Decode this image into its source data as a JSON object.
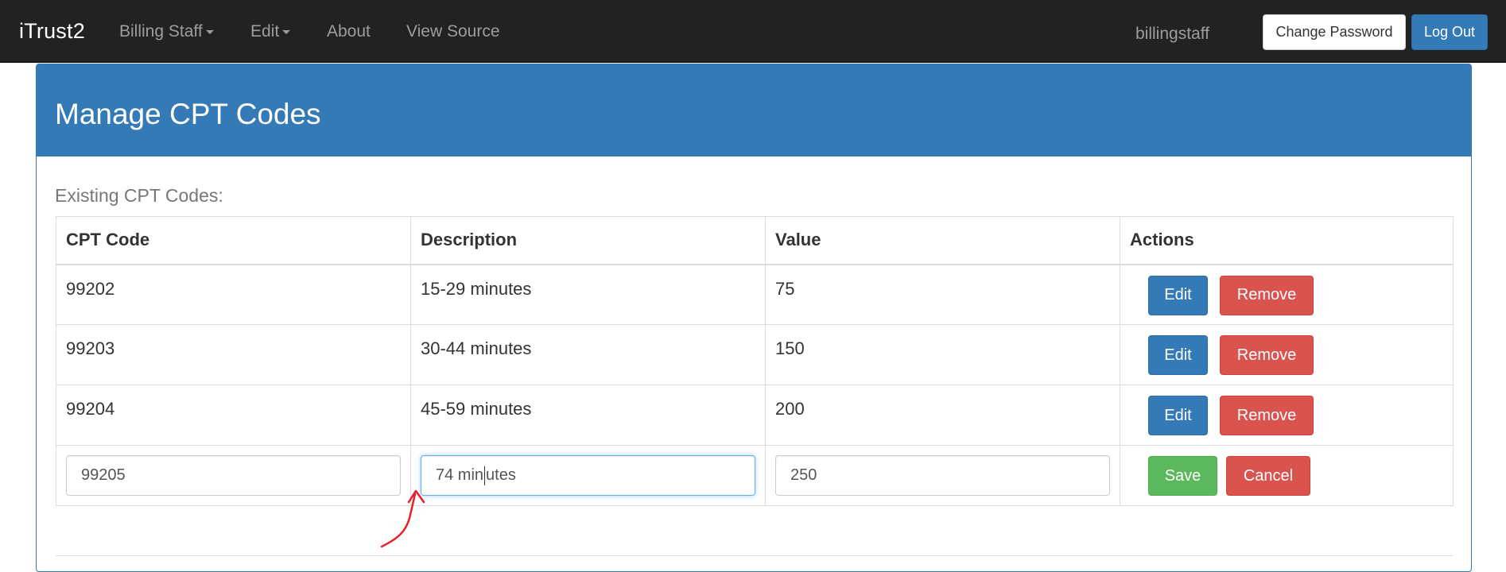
{
  "navbar": {
    "brand": "iTrust2",
    "menu": [
      {
        "label": "Billing Staff",
        "dropdown": true
      },
      {
        "label": "Edit",
        "dropdown": true
      },
      {
        "label": "About",
        "dropdown": false
      },
      {
        "label": "View Source",
        "dropdown": false
      }
    ],
    "username": "billingstaff",
    "change_password_label": "Change Password",
    "logout_label": "Log Out"
  },
  "panel": {
    "title": "Manage CPT Codes",
    "section_label": "Existing CPT Codes:"
  },
  "table": {
    "headers": [
      "CPT Code",
      "Description",
      "Value",
      "Actions"
    ],
    "rows": [
      {
        "code": "99202",
        "description": "15-29 minutes",
        "value": "75"
      },
      {
        "code": "99203",
        "description": "30-44 minutes",
        "value": "150"
      },
      {
        "code": "99204",
        "description": "45-59 minutes",
        "value": "200"
      }
    ],
    "edit_label": "Edit",
    "remove_label": "Remove",
    "edit_row": {
      "code": "99205",
      "description_before_cursor": "74 min",
      "description_after_cursor": "utes",
      "value": "250",
      "save_label": "Save",
      "cancel_label": "Cancel"
    }
  },
  "colors": {
    "navbar_bg": "#222222",
    "primary": "#337ab7",
    "danger": "#d9534f",
    "success": "#5cb85c",
    "annotation": "#e8202a"
  }
}
